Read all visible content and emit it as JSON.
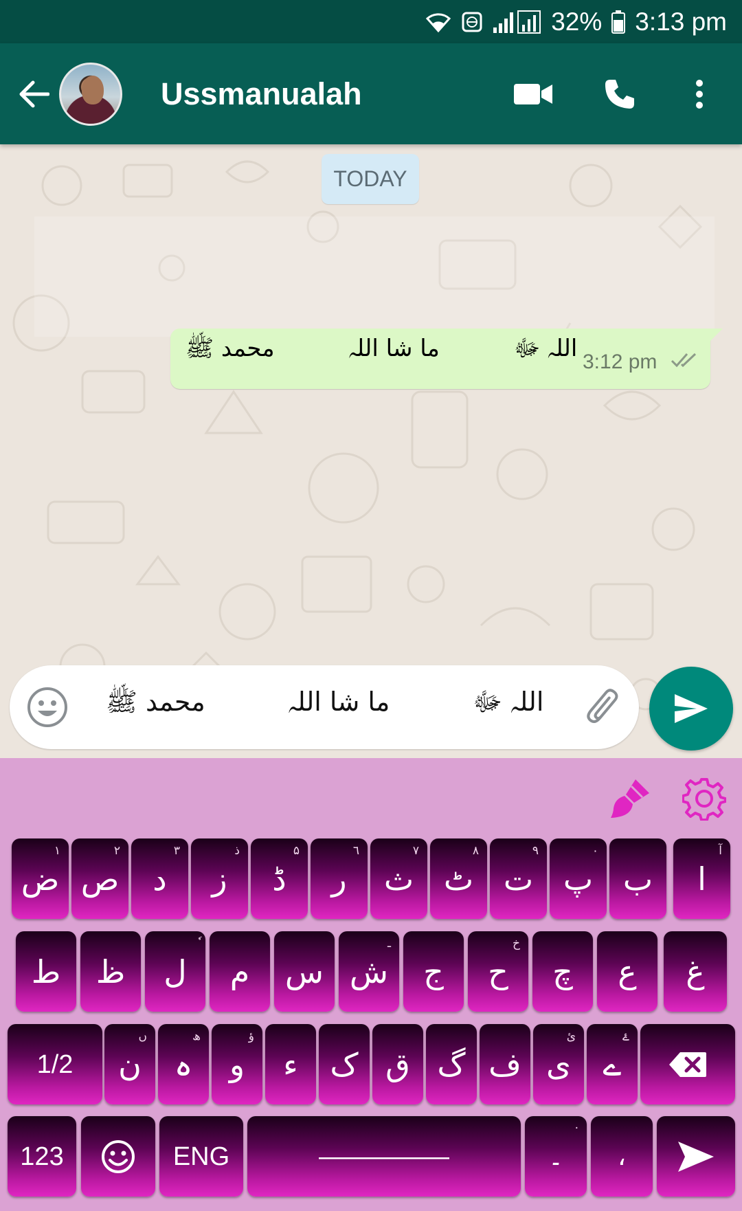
{
  "status_bar": {
    "battery": "32%",
    "time": "3:13 pm",
    "icons": [
      "wifi-icon",
      "vpn-globe-icon",
      "signal-icon",
      "battery-icon"
    ]
  },
  "header": {
    "contact_name": "Ussmanualah",
    "icons": [
      "back-arrow-icon",
      "video-call-icon",
      "phone-icon",
      "more-vert-icon"
    ]
  },
  "chat": {
    "date_chip": "TODAY",
    "messages": [
      {
        "text": "اللہ ﷻ          ما شا اللہ          محمد ﷺ",
        "time": "3:12 pm",
        "status": "delivered"
      }
    ]
  },
  "composer": {
    "text": "اللہ ﷻ          ما شا اللہ          محمد ﷺ",
    "icons": [
      "emoji-icon",
      "paperclip-icon",
      "send-icon"
    ]
  },
  "keyboard": {
    "toolbar_icons": [
      "paintbrush-icon",
      "settings-gear-icon"
    ],
    "rows": [
      [
        {
          "char": "ض",
          "hint": "۱"
        },
        {
          "char": "ص",
          "hint": "۲"
        },
        {
          "char": "د",
          "hint": "۳"
        },
        {
          "char": "ز",
          "hint": "ذ"
        },
        {
          "char": "ڈ",
          "hint": "۵"
        },
        {
          "char": "ر",
          "hint": "٦"
        },
        {
          "char": "ث",
          "hint": "۷"
        },
        {
          "char": "ٹ",
          "hint": "۸"
        },
        {
          "char": "ت",
          "hint": "۹"
        },
        {
          "char": "پ",
          "hint": "۰"
        },
        {
          "char": "ب",
          "hint": ""
        },
        {
          "char": "ا",
          "hint": "آ"
        }
      ],
      [
        {
          "char": "ط",
          "hint": ""
        },
        {
          "char": "ظ",
          "hint": ""
        },
        {
          "char": "ل",
          "hint": "ٗ"
        },
        {
          "char": "م",
          "hint": ""
        },
        {
          "char": "س",
          "hint": ""
        },
        {
          "char": "ش",
          "hint": "ـ"
        },
        {
          "char": "ج",
          "hint": ""
        },
        {
          "char": "ح",
          "hint": "خ"
        },
        {
          "char": "چ",
          "hint": ""
        },
        {
          "char": "ع",
          "hint": ""
        },
        {
          "char": "غ",
          "hint": ""
        }
      ],
      [
        {
          "char": "1/2",
          "hint": ""
        },
        {
          "char": "ن",
          "hint": "ں"
        },
        {
          "char": "ہ",
          "hint": "ھ"
        },
        {
          "char": "و",
          "hint": "ؤ"
        },
        {
          "char": "ء",
          "hint": ""
        },
        {
          "char": "ک",
          "hint": ""
        },
        {
          "char": "ق",
          "hint": ""
        },
        {
          "char": "گ",
          "hint": ""
        },
        {
          "char": "ف",
          "hint": ""
        },
        {
          "char": "ی",
          "hint": "ئ"
        },
        {
          "char": "ے",
          "hint": "ۓ"
        },
        {
          "char": "",
          "hint": ""
        }
      ],
      [
        {
          "char": "123",
          "hint": ""
        },
        {
          "char": "",
          "hint": ""
        },
        {
          "char": "ENG",
          "hint": ""
        },
        {
          "char": "—————",
          "hint": ""
        },
        {
          "char": "۔",
          "hint": "·"
        },
        {
          "char": "،",
          "hint": ""
        },
        {
          "char": "",
          "hint": ""
        }
      ]
    ]
  },
  "colors": {
    "status_bar": "#054d44",
    "app_bar": "#075e54",
    "bubble_out": "#dcf8c6",
    "fab": "#00897b",
    "keyboard_bg": "#dba2d3",
    "key_accent": "#e026c2"
  }
}
